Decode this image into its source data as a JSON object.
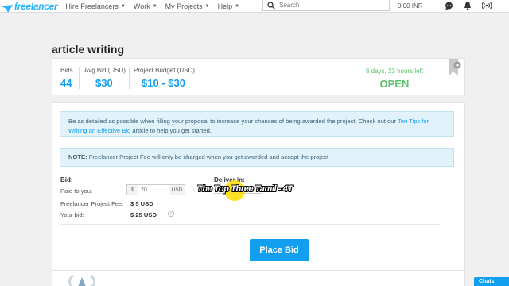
{
  "nav": {
    "logo_text": "freelancer",
    "items": [
      "Hire Freelancers",
      "Work",
      "My Projects",
      "Help"
    ],
    "search_placeholder": "Search",
    "balance": "0.00 INR"
  },
  "project": {
    "title": "article writing",
    "bids_label": "Bids",
    "bids_value": "44",
    "avg_label": "Avg Bid (USD)",
    "avg_value": "$30",
    "budget_label": "Project Budget (USD)",
    "budget_value": "$10 - $30",
    "time_left": "6 days, 23 hours left",
    "status": "OPEN"
  },
  "info": {
    "text_before": "Be as detailed as possible when filling your proposal to increase your chances of being awarded the project. Check out our ",
    "link": "Ten Tips for Writing an Effective Bid",
    "text_after": " article to help you get started.",
    "note_label": "NOTE:",
    "note_text": " Freelancer Project Fee will only be charged when you get awarded and accept the project"
  },
  "bid": {
    "label": "Bid:",
    "paid_label": "Paid to you:",
    "currency": "$",
    "paid_value": "20",
    "unit": "USD",
    "fee_label": "Freelancer Project Fee:",
    "fee_value": "$   5 USD",
    "your_bid_label": "Your bid:",
    "your_bid_value": "$   25 USD",
    "help": "?",
    "deliver_label": "Deliver in:",
    "overlay": "The Top Three Tamil - 4T"
  },
  "actions": {
    "place_bid": "Place Bid",
    "chats": "Chats"
  },
  "colors": {
    "brand": "#29b2fe",
    "accent": "#139ff0",
    "open": "#5dc26a"
  }
}
